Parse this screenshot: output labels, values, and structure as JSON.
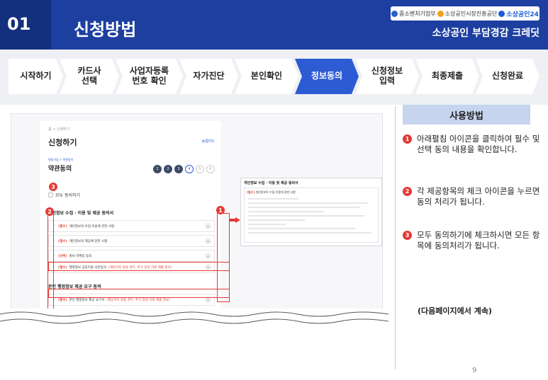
{
  "header": {
    "number": "01",
    "title": "신청방법",
    "logos": [
      "중소벤처기업부",
      "소상공인시장진흥공단",
      "소상공인24"
    ],
    "subtitle": "소상공인 부담경감 크레딧"
  },
  "steps": [
    {
      "label": "시작하기",
      "active": false
    },
    {
      "label": "카드사\n선택",
      "active": false
    },
    {
      "label": "사업자등록\n번호 확인",
      "active": false
    },
    {
      "label": "자가진단",
      "active": false
    },
    {
      "label": "본인확인",
      "active": false
    },
    {
      "label": "정보동의",
      "active": true
    },
    {
      "label": "신청정보\n입력",
      "active": false
    },
    {
      "label": "최종제출",
      "active": false
    },
    {
      "label": "신청완료",
      "active": false
    }
  ],
  "shot": {
    "crumb": "홈 > 신청하기",
    "title": "신청하기",
    "card_link": "농협카드",
    "substep": "회원가입 > 약관동의",
    "agree_title": "약관동의",
    "mini_steps": [
      "1",
      "2",
      "3",
      "4",
      "5",
      "6"
    ],
    "all_agree": "모두 동의하기",
    "section1": "개인정보 수집 · 이용 및 제공 동의서",
    "rows1": [
      {
        "req": "(필수)",
        "text": "개인정보의 수집·이용에 관한 사항",
        "warn": ""
      },
      {
        "req": "(필수)",
        "text": "개인정보의 제공에 관한 사항",
        "warn": ""
      },
      {
        "req": "(선택)",
        "text": "홍보 마케팅 동의",
        "warn": ""
      },
      {
        "req": "(필수)",
        "text": "행정정보 공동이용 사전동의",
        "warn": "(해당하지 않을 경우, 추가 증빙 자료 제출 필요)"
      }
    ],
    "section2": "본인 행정정보 제공 요구 동의",
    "rows2": [
      {
        "req": "(필수)",
        "text": "본인 행정정보 제공 요구서",
        "warn": "(해당하지 않을 경우, 추가 증빙 자료 제출 필요)"
      }
    ],
    "detail_title": "개인정보 수집 · 이용 및 제공 동의서",
    "detail_head_req": "(필수)",
    "detail_head": "개인정보의 수집·이용에 관한 사항",
    "detail_label": "개인정보 수집 · 이용 및 제공 동의서",
    "badges": [
      "1",
      "2",
      "3"
    ]
  },
  "usage": {
    "title": "사용방법",
    "items": [
      {
        "num": "1",
        "text": "아래펼침 아이콘을 클릭하여 필수 및 선택 동의 내용을 확인합니다."
      },
      {
        "num": "2",
        "text": "각 제공항목의  체크 아이콘을 누르면 동의 처리가 됩니다."
      },
      {
        "num": "3",
        "text": "모두 동의하기에 체크하시면 모든 항목에 동의처리가 됩니다."
      }
    ],
    "continue": "(다음페이지에서 계속)"
  },
  "page_number": "9",
  "colors": {
    "header": "#1d3fa0",
    "active_step": "#2d5bd4",
    "badge": "#e53935",
    "usage_head": "#c6d4ee"
  }
}
